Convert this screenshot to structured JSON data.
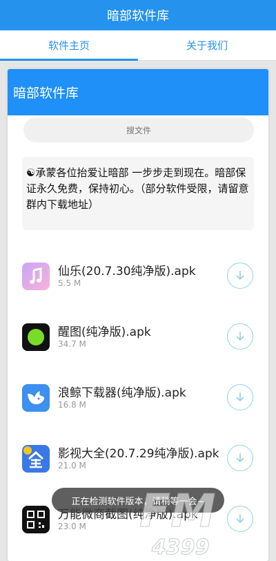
{
  "appbar": {
    "title": "暗部软件库"
  },
  "tabs": [
    {
      "label": "软件主页",
      "active": true
    },
    {
      "label": "关于我们",
      "active": false
    }
  ],
  "card": {
    "header_title": "暗部软件库",
    "search_placeholder": "搜文件",
    "notice": "☯承蒙各位抬爱让暗部 一步步走到现在。暗部保证永久免费，保持初心。（部分软件受限，请留意群内下载地址）"
  },
  "apps": [
    {
      "name": "仙乐(20.7.30纯净版).apk",
      "size": "5.5 M",
      "icon": "music-note-icon"
    },
    {
      "name": "醒图(纯净版).apk",
      "size": "34.7 M",
      "icon": "green-dot-icon"
    },
    {
      "name": "浪鲸下载器(纯净版).apk",
      "size": "16.8 M",
      "icon": "whale-icon"
    },
    {
      "name": "影视大全(20.7.29纯净版).apk",
      "size": "21.0 M",
      "icon": "quan-icon"
    },
    {
      "name": "万能微商截图(纯净版).apk",
      "size": "23.0 M",
      "icon": "qr-icon"
    }
  ],
  "toast": {
    "text": "正在检测软件版本，请稍等一会~"
  },
  "watermark": {
    "text": "4399",
    "brand": "FM"
  },
  "colors": {
    "primary": "#2592ee",
    "download_ring": "#8fd3e0"
  }
}
